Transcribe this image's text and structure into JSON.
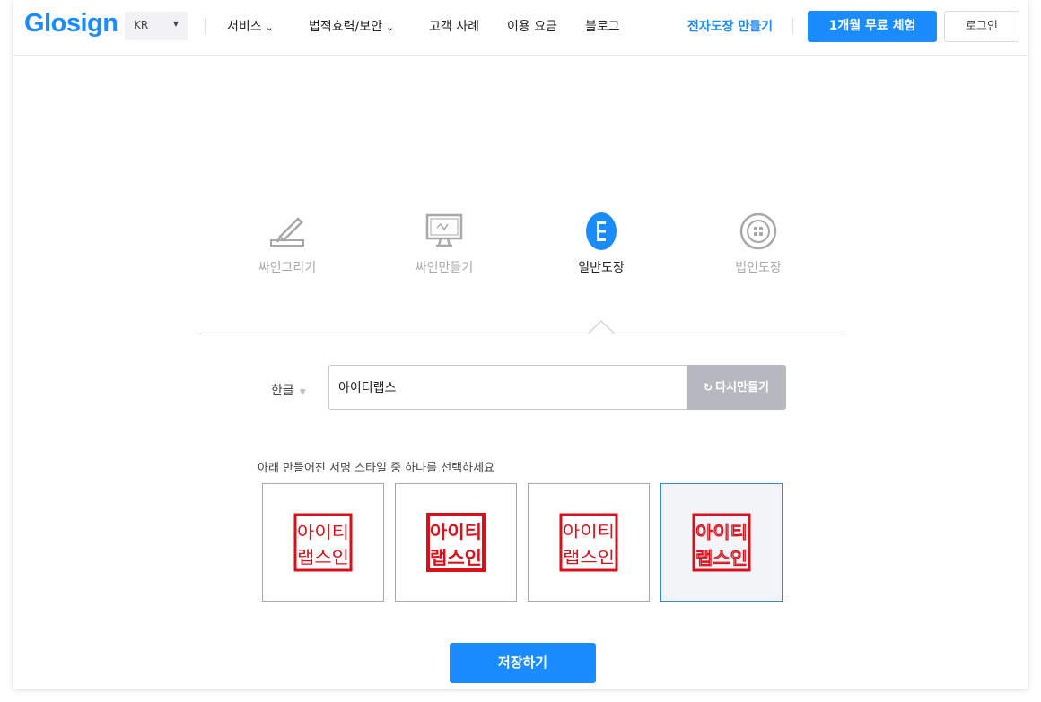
{
  "header": {
    "logo": "Glosign",
    "language": "KR",
    "nav": [
      "서비스",
      "법적효력/보안",
      "고객 사례",
      "이용 요금",
      "블로그"
    ],
    "make_stamp": "전자도장 만들기",
    "trial_button": "1개월 무료 체험",
    "login_button": "로그인"
  },
  "tabs": [
    {
      "label": "싸인그리기",
      "icon": "pen-draw-icon"
    },
    {
      "label": "싸인만들기",
      "icon": "monitor-sign-icon"
    },
    {
      "label": "일반도장",
      "icon": "stamp-icon",
      "active": true
    },
    {
      "label": "법인도장",
      "icon": "corporate-seal-icon"
    }
  ],
  "form": {
    "script": "한글",
    "name_value": "아이티랩스",
    "regenerate_button": "다시만들기",
    "instruction": "아래 만들어진 서명 스타일 중 하나를 선택하세요"
  },
  "stamps": {
    "styles": 4,
    "selected_index": 3,
    "lettering": "아이티랩스인",
    "color": "#d8121b"
  },
  "save_button": "저장하기",
  "colors": {
    "primary": "#1a8cff",
    "stamp_red": "#d8121b",
    "disabled": "#b6b9bf"
  }
}
